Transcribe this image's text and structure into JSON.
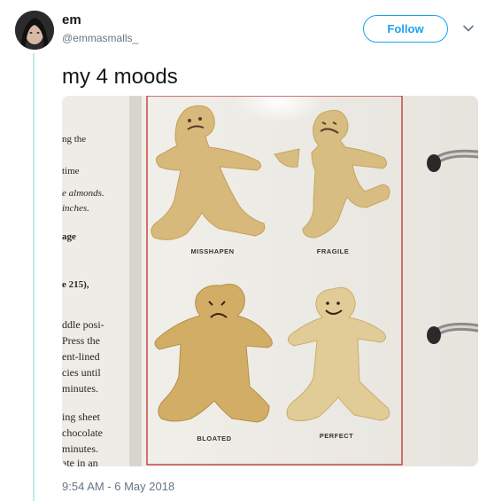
{
  "tweet": {
    "author_name": "em",
    "author_handle": "@emmasmalls_",
    "follow_label": "Follow",
    "text": "my 4 moods",
    "timestamp": "9:54 AM - 6 May 2018"
  },
  "photo": {
    "labels": {
      "misshapen": "MISSHAPEN",
      "fragile": "FRAGILE",
      "bloated": "BLOATED",
      "perfect": "PERFECT"
    },
    "left_page_lines": [
      "ng the",
      "time",
      "e almonds.",
      "inches.",
      "age",
      "e 215),",
      "ddle posi-",
      "Press the",
      "ent-lined",
      "cies until",
      "minutes.",
      "ing sheet",
      "chocolate",
      "minutes.",
      "ate in an"
    ]
  },
  "icons": {
    "chevron": "chevron-down-icon"
  }
}
